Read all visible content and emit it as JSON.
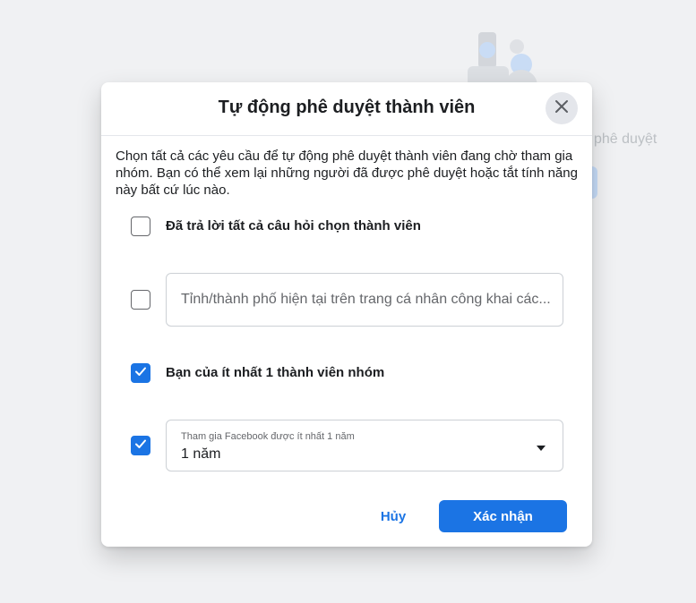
{
  "background": {
    "partial_text": "phê duyệt"
  },
  "modal": {
    "title": "Tự động phê duyệt thành viên",
    "description": "Chọn tất cả các yêu cầu để tự động phê duyệt thành viên đang chờ tham gia nhóm. Bạn có thể xem lại những người đã được phê duyệt hoặc tắt tính năng này bất cứ lúc nào.",
    "criteria": {
      "answered_questions": {
        "label": "Đã trả lời tất cả câu hỏi chọn thành viên",
        "checked": false
      },
      "location": {
        "placeholder": "Tỉnh/thành phố hiện tại trên trang cá nhân công khai các...",
        "value": "",
        "checked": false
      },
      "friend_of_member": {
        "label": "Bạn của ít nhất 1 thành viên nhóm",
        "checked": true
      },
      "facebook_tenure": {
        "select_label": "Tham gia Facebook được ít nhất 1 năm",
        "selected": "1 năm",
        "checked": true
      }
    },
    "buttons": {
      "cancel": "Hủy",
      "confirm": "Xác nhận"
    }
  },
  "icons": {
    "close": "close-icon",
    "check": "checkmark-icon",
    "caret": "caret-down-icon"
  },
  "colors": {
    "accent": "#1b74e4",
    "backdrop": "#f0f1f3",
    "secondary_button": "#e4e6eb"
  }
}
